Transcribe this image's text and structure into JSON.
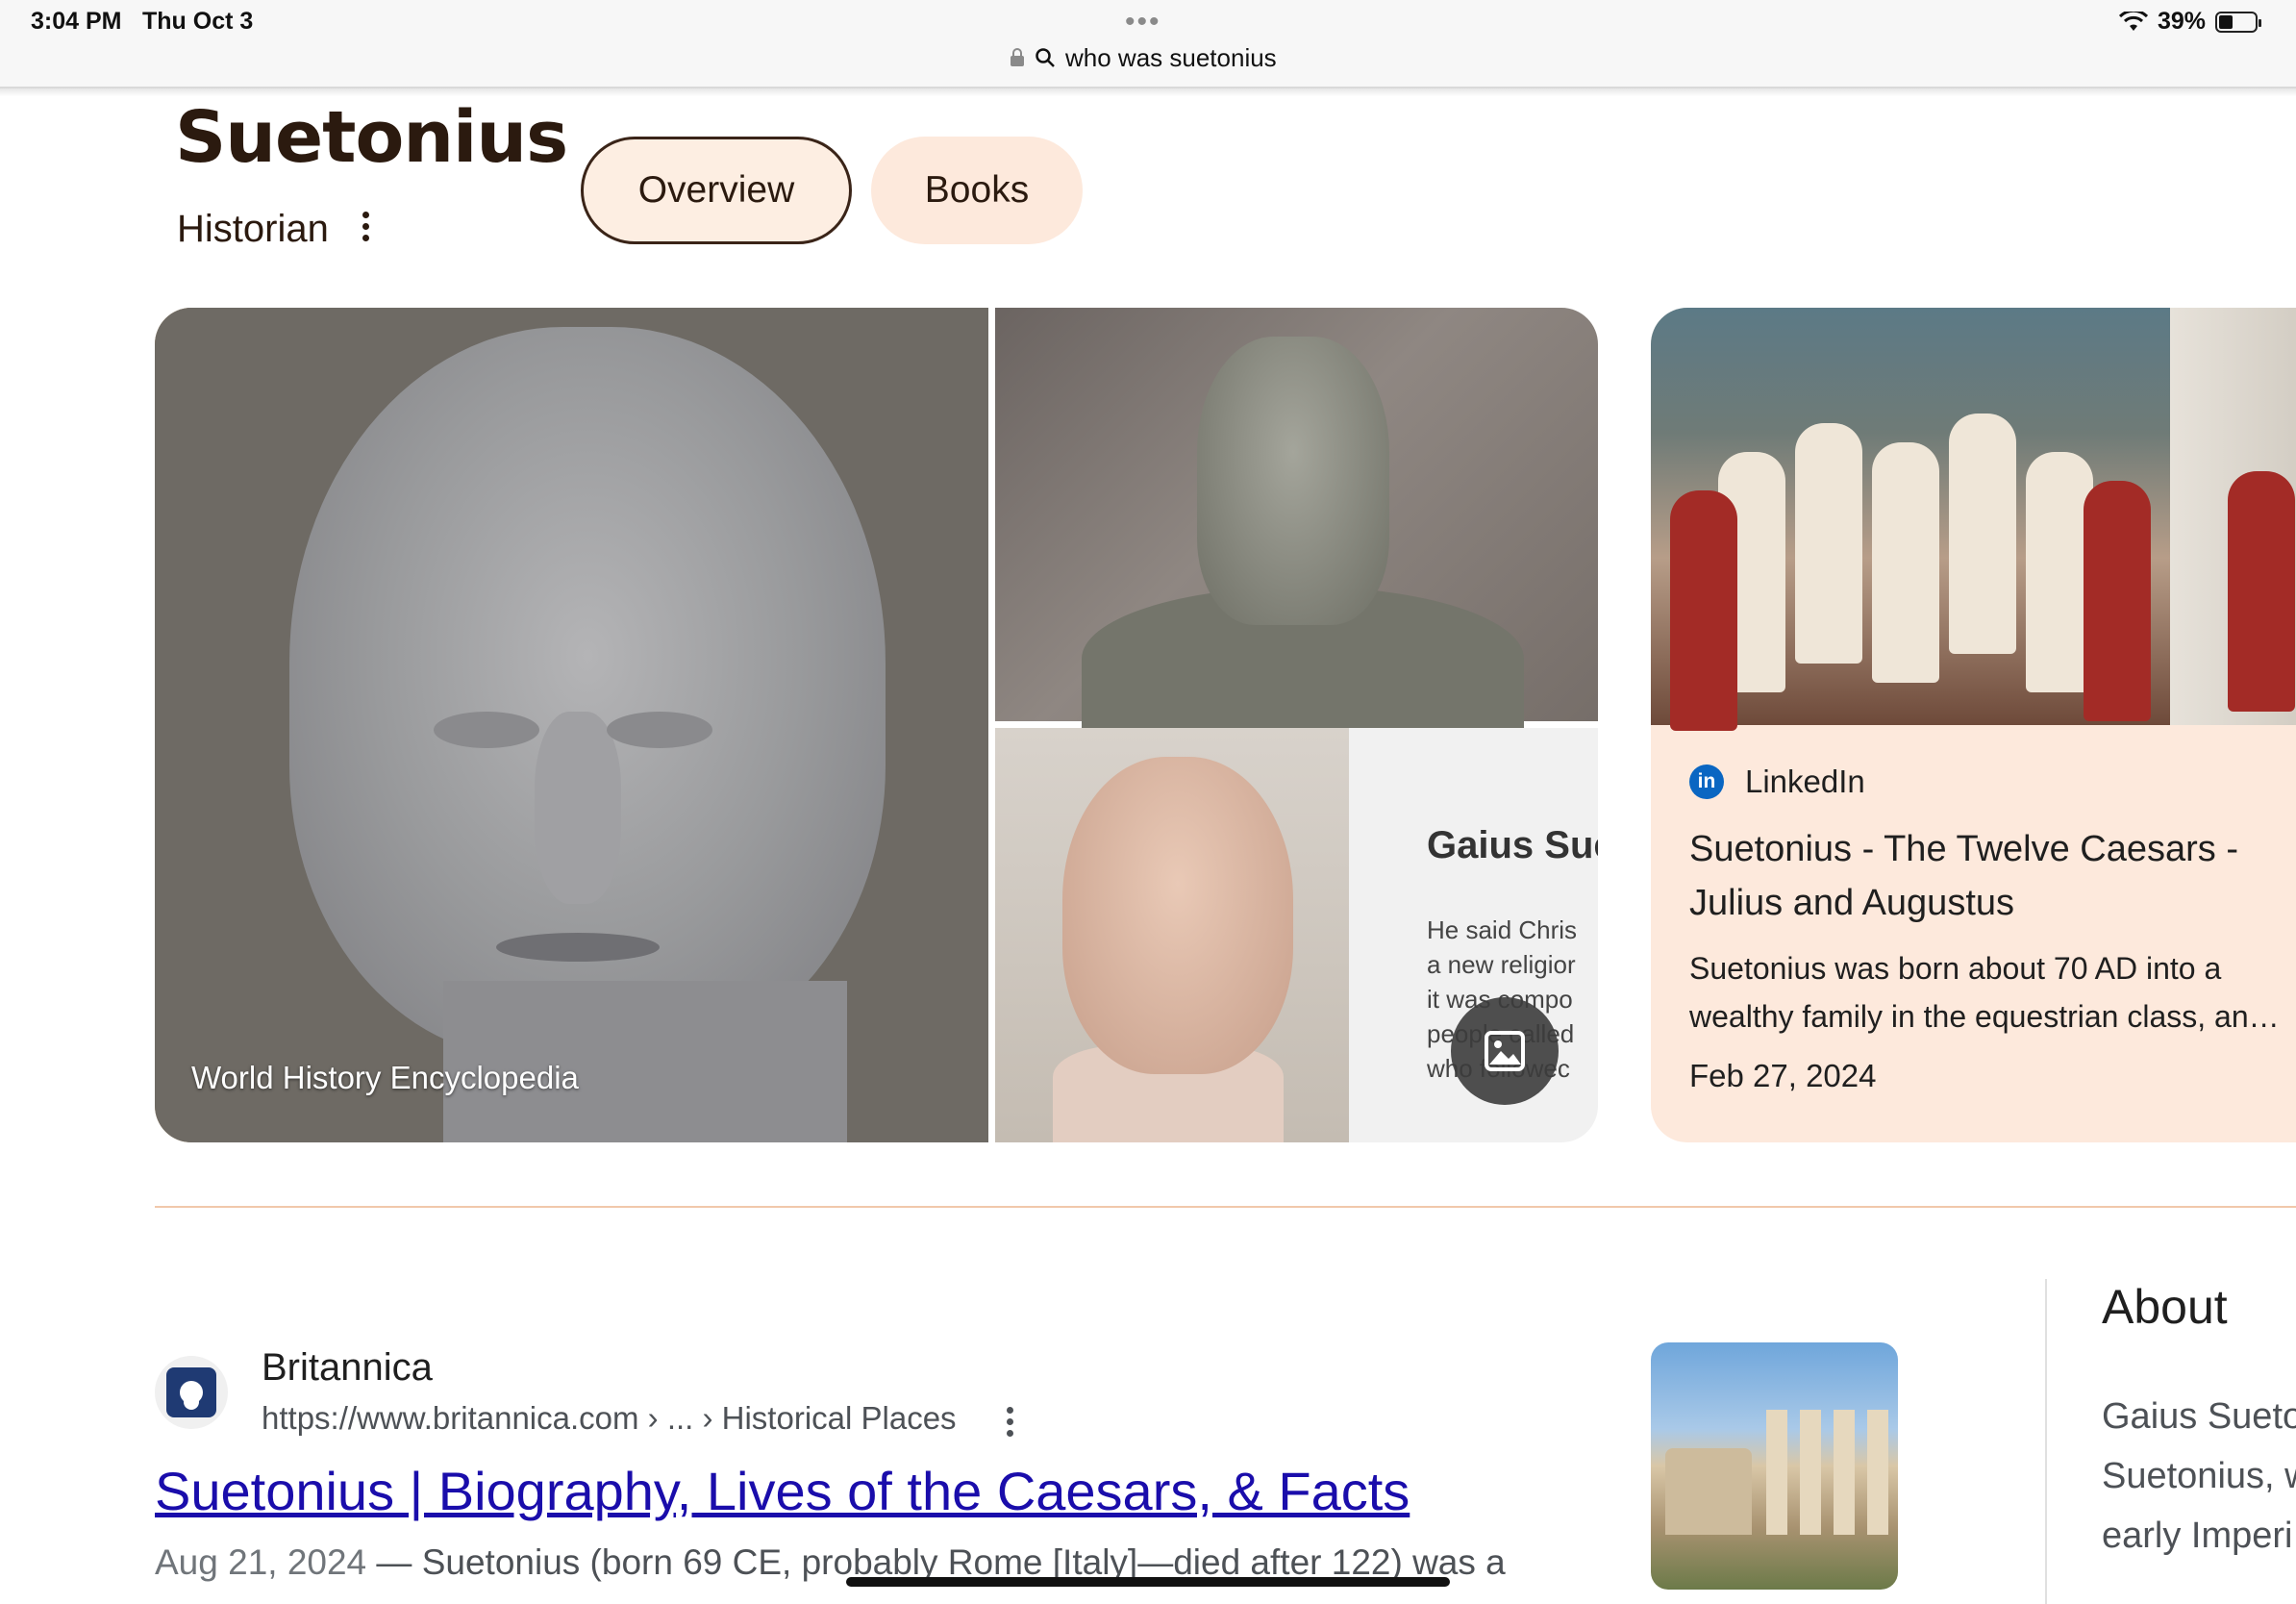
{
  "status_bar": {
    "time": "3:04 PM",
    "date": "Thu Oct 3",
    "battery": "39%",
    "battery_level": 0.39
  },
  "address_bar": {
    "query": "who was suetonius"
  },
  "knowledge_panel": {
    "title": "Suetonius",
    "subtitle": "Historian",
    "tabs": [
      {
        "label": "Overview",
        "selected": true
      },
      {
        "label": "Books",
        "selected": false
      }
    ]
  },
  "images": {
    "main_caption": "World History Encyclopedia",
    "overlay_title": "Gaius Sue",
    "overlay_text": "He said Chris\na new religior\nit was compo\npeople called\nwho followec"
  },
  "linkedin_card": {
    "source": "LinkedIn",
    "title": "Suetonius - The Twelve Caesars - Julius and Augustus",
    "snippet_line1": "Suetonius was born about 70 AD into a",
    "snippet_line2": "wealthy family in the equestrian class, an…",
    "date": "Feb 27, 2024"
  },
  "result": {
    "site": "Britannica",
    "url": "https://www.britannica.com › ... › Historical Places",
    "title": "Suetonius | Biography, Lives of the Caesars, & Facts",
    "date": "Aug 21, 2024",
    "snippet": " — Suetonius (born 69 CE, probably Rome [Italy]—died after 122) was a"
  },
  "about": {
    "heading": "About",
    "lines": [
      "Gaius Sueto",
      "Suetonius, w",
      "early Imperi"
    ]
  },
  "colors": {
    "chip_bg": "#fdeee2",
    "card_bg": "#fde9dc",
    "link": "#1a0dab",
    "divider": "#f1c8ab"
  }
}
